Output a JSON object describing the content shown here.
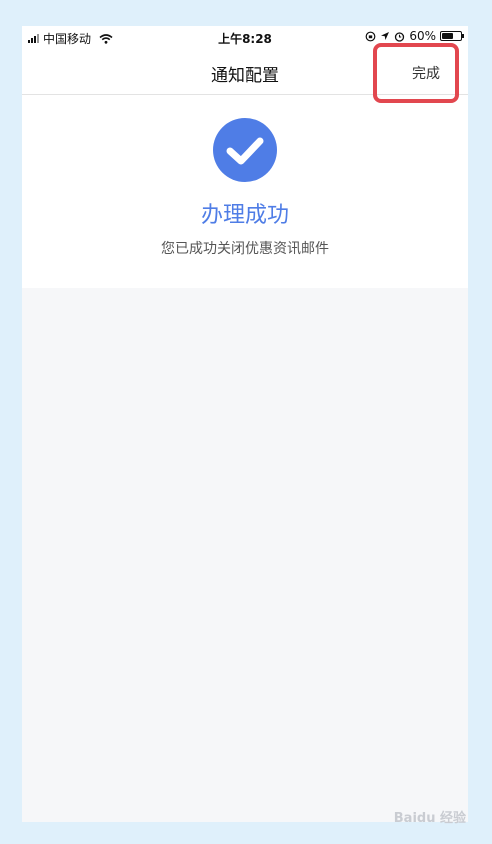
{
  "status_bar": {
    "carrier": "中国移动",
    "time": "上午8:28",
    "battery": "60%",
    "battery_level": 0.6
  },
  "nav": {
    "title": "通知配置",
    "done_label": "完成"
  },
  "result": {
    "title": "办理成功",
    "description": "您已成功关闭优惠资讯邮件"
  },
  "watermark": "Baidu 经验",
  "colors": {
    "accent": "#4f7de6",
    "highlight": "#e2474f",
    "page_bg": "#dff0fb"
  }
}
